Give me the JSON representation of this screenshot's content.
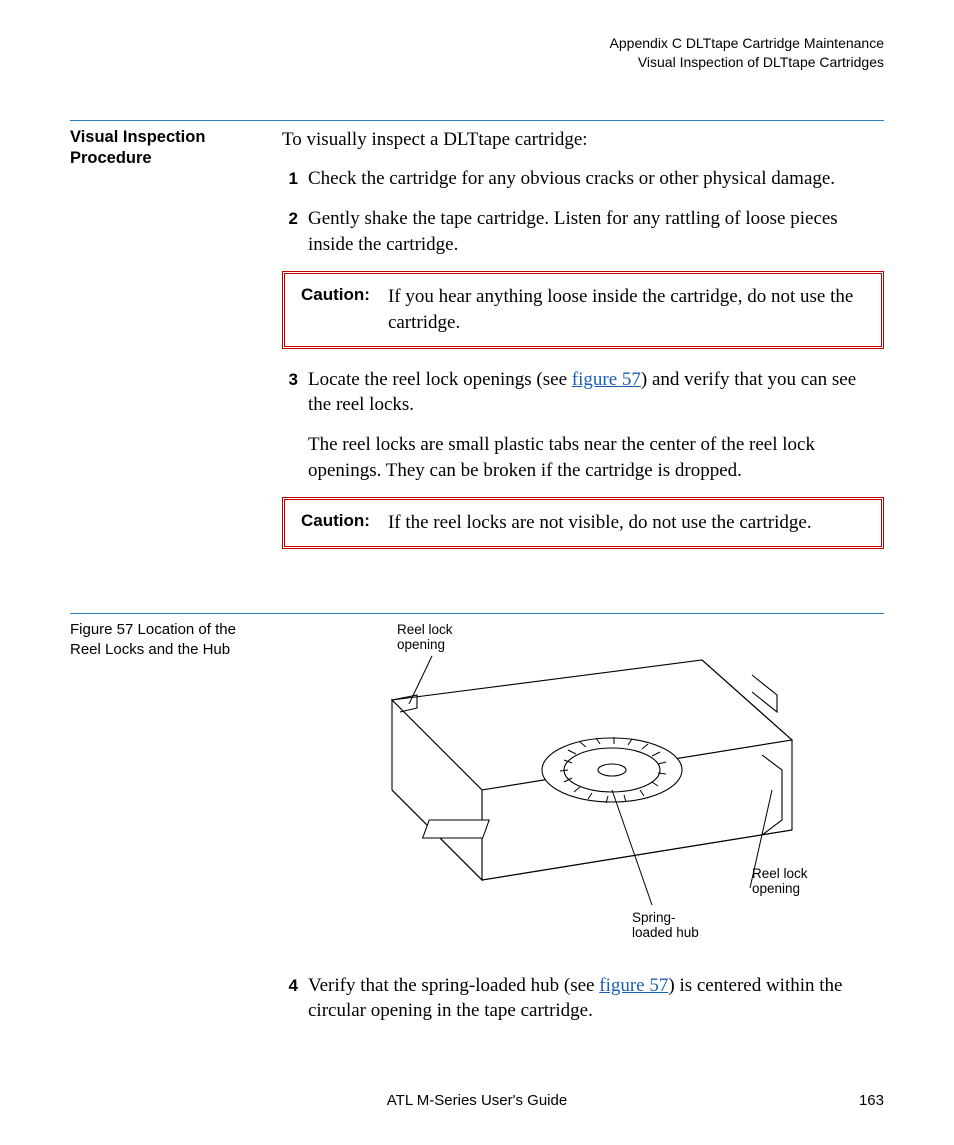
{
  "header": {
    "line1": "Appendix C  DLTtape Cartridge Maintenance",
    "line2": "Visual Inspection of DLTtape Cartridges"
  },
  "section": {
    "side_heading": "Visual Inspection Procedure",
    "intro": "To visually inspect a DLTtape cartridge:",
    "steps": {
      "s1": {
        "num": "1",
        "text": "Check the cartridge for any obvious cracks or other physical damage."
      },
      "s2": {
        "num": "2",
        "text": "Gently shake the tape cartridge. Listen for any rattling of loose pieces inside the cartridge."
      },
      "s3": {
        "num": "3",
        "pre": "Locate the reel lock openings (see ",
        "link": "figure 57",
        "post": ") and verify that you can see the reel locks."
      },
      "s3_para": "The reel locks are small plastic tabs near the center of the reel lock openings. They can be broken if the cartridge is dropped.",
      "s4": {
        "num": "4",
        "pre": "Verify that the spring-loaded hub (see ",
        "link": "figure 57",
        "post": ") is centered within the circular opening in the tape cartridge."
      }
    },
    "caution1": {
      "label": "Caution:",
      "text": "If you hear anything loose inside the cartridge, do not use the cartridge."
    },
    "caution2": {
      "label": "Caution:",
      "text": "If the reel locks are not visible, do not use the cartridge."
    }
  },
  "figure": {
    "caption": "Figure 57  Location of the Reel Locks and the Hub",
    "callouts": {
      "top": "Reel lock\nopening",
      "left": "Spring-\nloaded hub",
      "right": "Reel lock\nopening"
    }
  },
  "footer": {
    "title": "ATL M-Series User's Guide",
    "page": "163"
  }
}
